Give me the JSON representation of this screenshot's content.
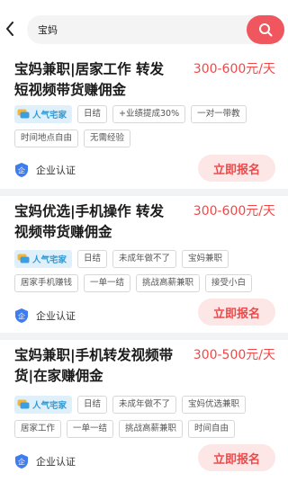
{
  "search": {
    "query": "宝妈"
  },
  "jobs": [
    {
      "title": "宝妈兼职|居家工作 转发短视频带货赚佣金",
      "salary": "300-600元/天",
      "hot_tag": "人气宅家",
      "tags_row1": [
        "日结",
        "+业绩提成30%",
        "一对一带教"
      ],
      "tags_row2": [
        "时间地点自由",
        "无需经验"
      ],
      "verify_label": "企业认证",
      "apply_label": "立即报名"
    },
    {
      "title": "宝妈优选|手机操作 转发视频带货赚佣金",
      "salary": "300-600元/天",
      "hot_tag": "人气宅家",
      "tags_row1": [
        "日结",
        "未成年做不了",
        "宝妈兼职"
      ],
      "tags_row2": [
        "居家手机赚钱",
        "一单一结",
        "挑战高薪兼职",
        "接受小白"
      ],
      "verify_label": "企业认证",
      "apply_label": "立即报名"
    },
    {
      "title": "宝妈兼职|手机转发视频带货|在家赚佣金",
      "salary": "300-500元/天",
      "hot_tag": "人气宅家",
      "tags_row1": [
        "日结",
        "未成年做不了",
        "宝妈优选兼职"
      ],
      "tags_row2": [
        "居家工作",
        "一单一结",
        "挑战高薪兼职",
        "时间自由"
      ],
      "verify_label": "企业认证",
      "apply_label": "立即报名"
    }
  ],
  "icons": {
    "back": "back-arrow-icon",
    "search": "search-icon",
    "verify": "shield-verified-icon",
    "hot": "chat-bubble-icon"
  },
  "colors": {
    "accent": "#f0565d",
    "salary": "#f04848",
    "hot_tag_bg": "#dff0fb",
    "hot_tag_text": "#2f9ad6",
    "apply_bg": "#fde6e6"
  }
}
